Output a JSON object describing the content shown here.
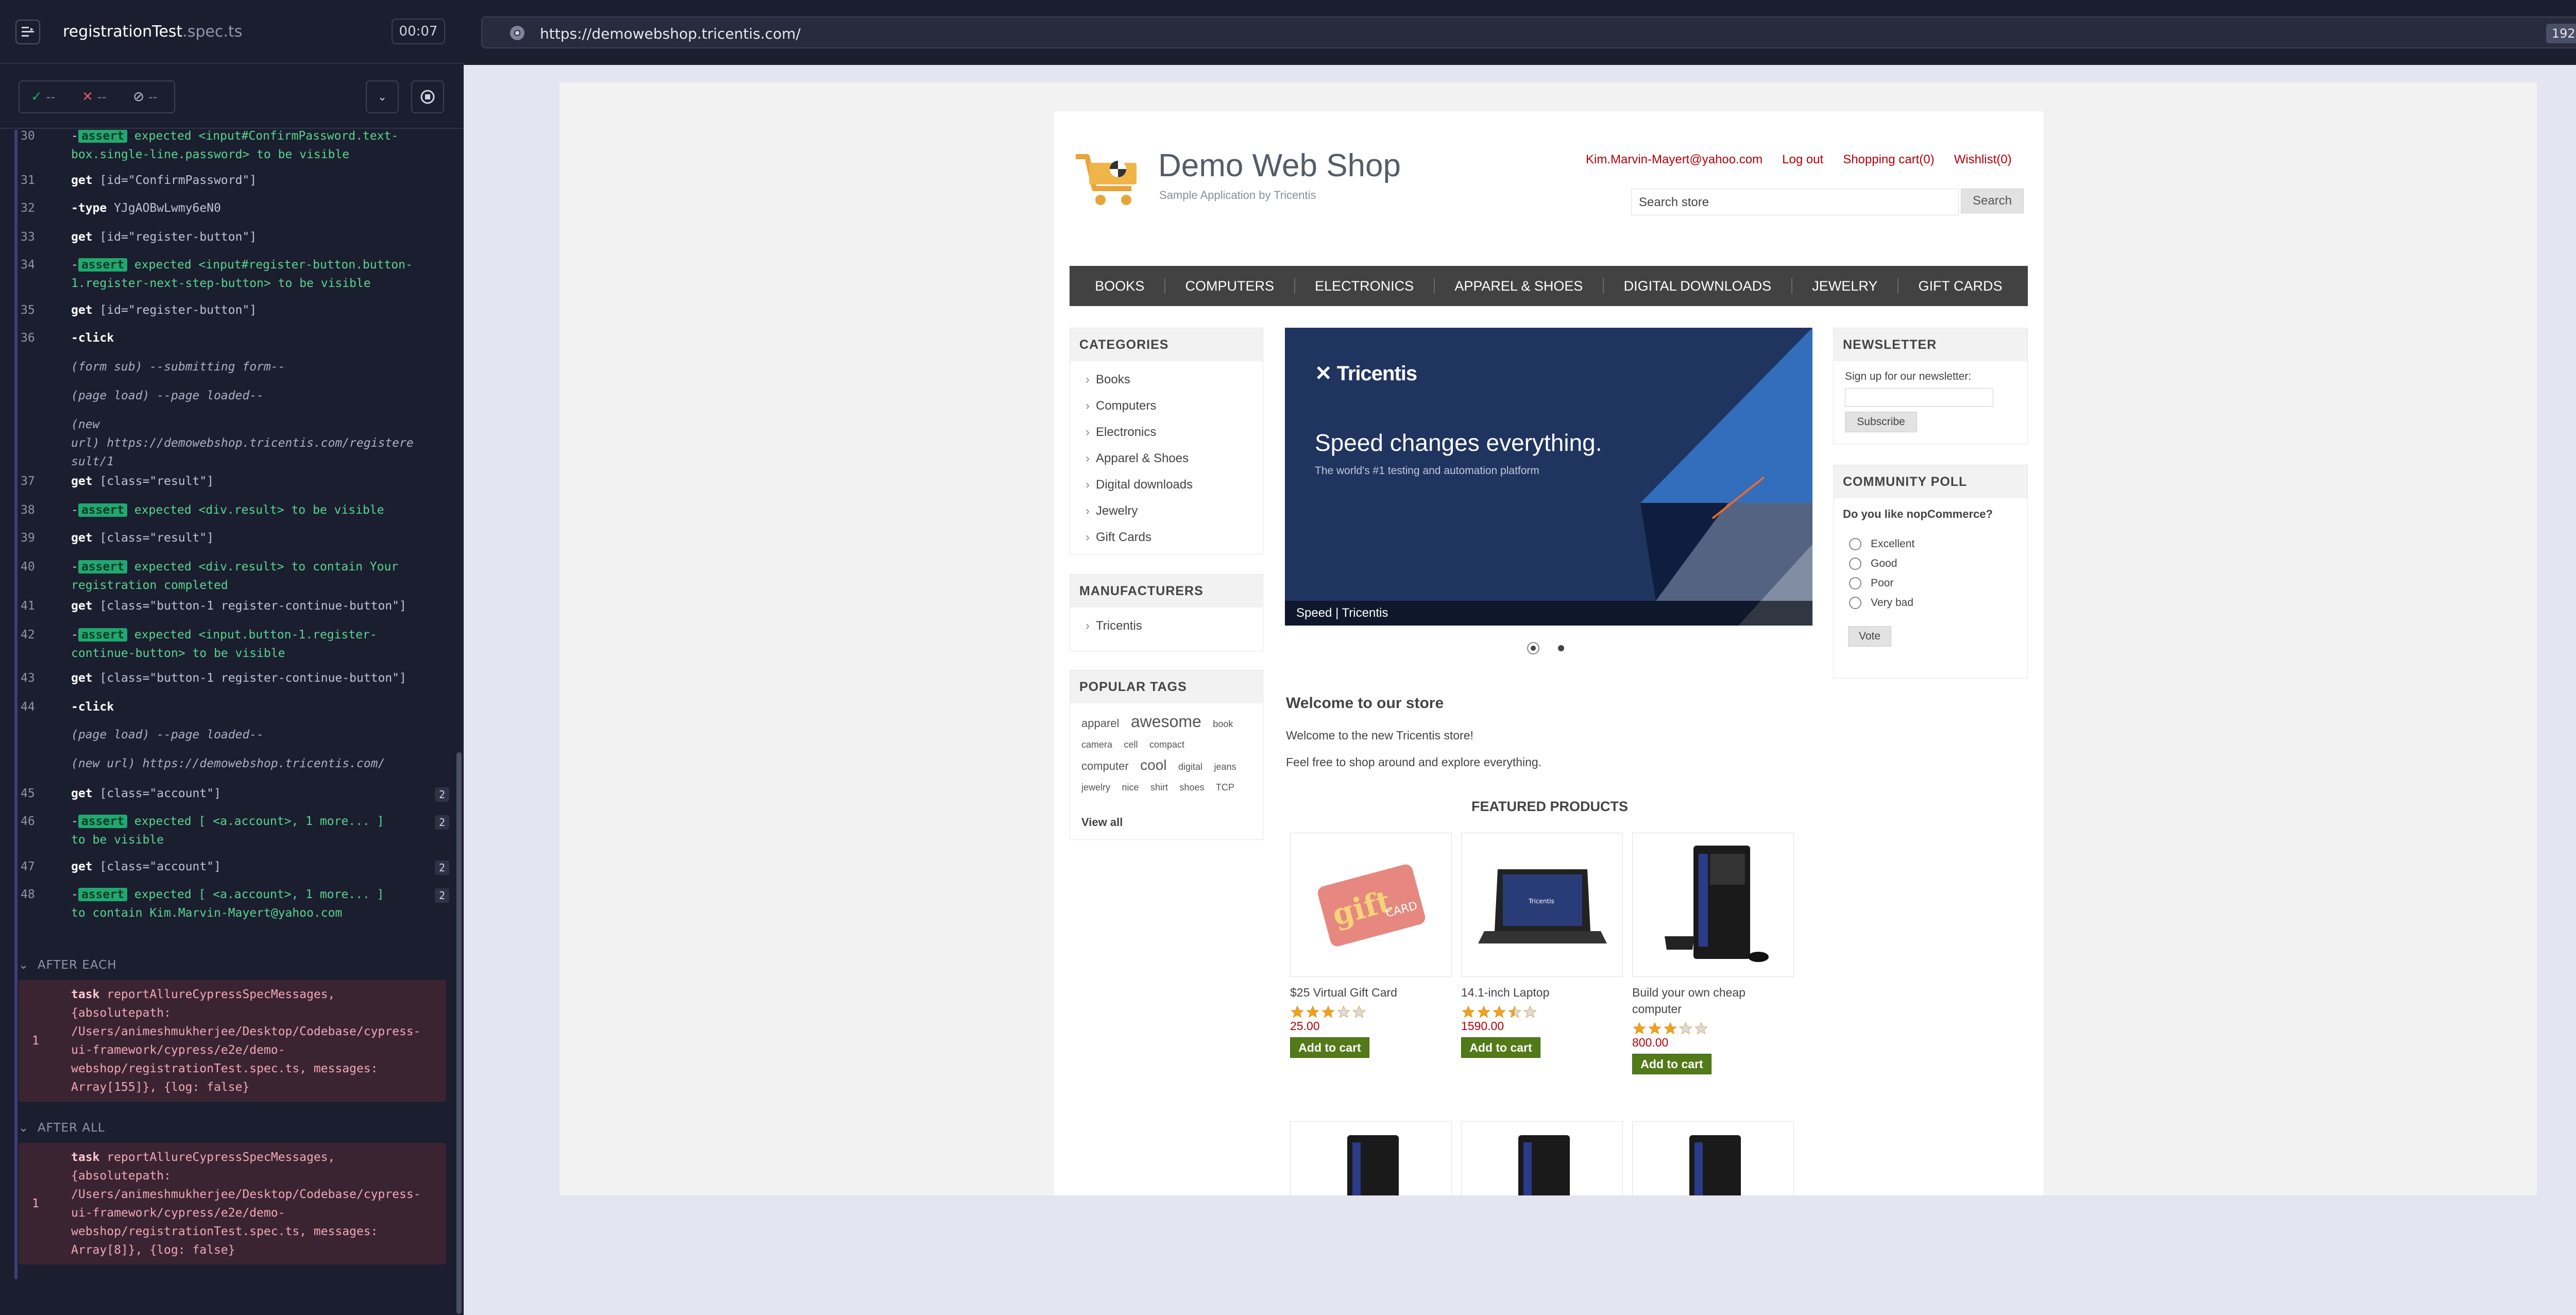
{
  "runner": {
    "spec_name": "registrationTest",
    "spec_ext": ".spec.ts",
    "timer": "00:07",
    "stats": {
      "passed": "--",
      "failed": "--",
      "pending": "--"
    }
  },
  "commands": [
    {
      "num": "30",
      "line1_pre": "",
      "tag": "assert",
      "line1": " expected <input#ConfirmPassword.text-",
      "line2": "box.single-line.password> to be visible"
    },
    {
      "num": "31",
      "kw": "get",
      "text": "[id=\"ConfirmPassword\"]"
    },
    {
      "num": "32",
      "kw": "-type",
      "text": "YJgAOBwLwmy6eN0"
    },
    {
      "num": "33",
      "kw": "get",
      "text": "[id=\"register-button\"]"
    },
    {
      "num": "34",
      "tag": "assert",
      "line1": " expected <input#register-button.button-",
      "line2": "1.register-next-step-button> to be visible"
    },
    {
      "num": "35",
      "kw": "get",
      "text": "[id=\"register-button\"]"
    },
    {
      "num": "36",
      "kw": "-click",
      "text": ""
    },
    {
      "num": "",
      "it1": "(form sub)",
      "text": "--submitting form--"
    },
    {
      "num": "",
      "it1": "(page load)",
      "text": "--page loaded--"
    },
    {
      "num": "",
      "it1": "(new",
      "line1": "",
      "it2": "url)",
      "line2": "https://demowebshop.tricentis.com/registere",
      "line3": "sult/1"
    },
    {
      "num": "37",
      "kw": "get",
      "text": "[class=\"result\"]"
    },
    {
      "num": "38",
      "tag": "assert",
      "line1": " expected <div.result> to be visible"
    },
    {
      "num": "39",
      "kw": "get",
      "text": "[class=\"result\"]"
    },
    {
      "num": "40",
      "tag": "assert",
      "line1": " expected <div.result> to contain Your",
      "line2": "registration completed"
    },
    {
      "num": "41",
      "kw": "get",
      "text": "[class=\"button-1 register-continue-button\"]"
    },
    {
      "num": "42",
      "tag": "assert",
      "line1": " expected <input.button-1.register-",
      "line2": "continue-button> to be visible"
    },
    {
      "num": "43",
      "kw": "get",
      "text": "[class=\"button-1 register-continue-button\"]"
    },
    {
      "num": "44",
      "kw": "-click",
      "text": ""
    },
    {
      "num": "",
      "it1": "(page load)",
      "text": "--page loaded--"
    },
    {
      "num": "",
      "it1": "(new url)",
      "text": "https://demowebshop.tricentis.com/"
    },
    {
      "num": "45",
      "kw": "get",
      "text": "[class=\"account\"]",
      "badge": "2"
    },
    {
      "num": "46",
      "tag": "assert",
      "line1": " expected [ <a.account>, 1 more... ]",
      "line2": "to be visible",
      "badge": "2"
    },
    {
      "num": "47",
      "kw": "get",
      "text": "[class=\"account\"]",
      "badge": "2"
    },
    {
      "num": "48",
      "tag": "assert",
      "line1": " expected [ <a.account>, 1 more... ]",
      "line2": "to contain Kim.Marvin-Mayert@yahoo.com",
      "badge": "2"
    }
  ],
  "hooks": {
    "after_each_label": "AFTER EACH",
    "after_each": {
      "num": "1",
      "kw": "task",
      "lines": [
        "reportAllureCypressSpecMessages,",
        "{absolutepath:",
        "/Users/animeshmukherjee/Desktop/Codebase/cypress-",
        "ui-framework/cypress/e2e/demo-",
        "webshop/registrationTest.spec.ts, messages:",
        "Array[155]}, {log: false}"
      ]
    },
    "after_all_label": "AFTER ALL",
    "after_all": {
      "num": "1",
      "kw": "task",
      "lines": [
        "reportAllureCypressSpecMessages,",
        "{absolutepath:",
        "/Users/animeshmukherjee/Desktop/Codebase/cypress-",
        "ui-framework/cypress/e2e/demo-",
        "webshop/registrationTest.spec.ts, messages:",
        "Array[8]}, {log: false}"
      ]
    }
  },
  "browser": {
    "url": "https://demowebshop.tricentis.com/",
    "viewport": "1920x1080"
  },
  "shop": {
    "title": "Demo Web Shop",
    "subtitle": "Sample Application by Tricentis",
    "header_links": [
      "Kim.Marvin-Mayert@yahoo.com",
      "Log out",
      "Shopping cart(0)",
      "Wishlist(0)"
    ],
    "search_placeholder": "Search store",
    "search_button": "Search",
    "menu": [
      "BOOKS",
      "COMPUTERS",
      "ELECTRONICS",
      "APPAREL & SHOES",
      "DIGITAL DOWNLOADS",
      "JEWELRY",
      "GIFT CARDS"
    ],
    "categories_title": "CATEGORIES",
    "categories": [
      "Books",
      "Computers",
      "Electronics",
      "Apparel & Shoes",
      "Digital downloads",
      "Jewelry",
      "Gift Cards"
    ],
    "manufacturers_title": "MANUFACTURERS",
    "manufacturers": [
      "Tricentis"
    ],
    "tags_title": "POPULAR TAGS",
    "tags": [
      {
        "t": "apparel",
        "s": "m"
      },
      {
        "t": "awesome",
        "s": "xl"
      },
      {
        "t": "book",
        "s": "s"
      },
      {
        "t": "camera",
        "s": "s"
      },
      {
        "t": "cell",
        "s": "s"
      },
      {
        "t": "compact",
        "s": "s"
      },
      {
        "t": "computer",
        "s": "m"
      },
      {
        "t": "cool",
        "s": "l"
      },
      {
        "t": "digital",
        "s": "s"
      },
      {
        "t": "jeans",
        "s": "s"
      },
      {
        "t": "jewelry",
        "s": "s"
      },
      {
        "t": "nice",
        "s": "s"
      },
      {
        "t": "shirt",
        "s": "s"
      },
      {
        "t": "shoes",
        "s": "s"
      },
      {
        "t": "TCP",
        "s": "s"
      }
    ],
    "tags_view_all": "View all",
    "slider": {
      "logo": "Tricentis",
      "headline": "Speed changes everything.",
      "sub": "The world's #1 testing and automation platform",
      "caption": "Speed | Tricentis"
    },
    "welcome_title": "Welcome to our store",
    "welcome_1": "Welcome to the new Tricentis store!",
    "welcome_2": "Feel free to shop around and explore everything.",
    "featured_title": "FEATURED PRODUCTS",
    "products": [
      {
        "name": "$25 Virtual Gift Card",
        "price": "25.00",
        "rating": 3,
        "button": "Add to cart"
      },
      {
        "name": "14.1-inch Laptop",
        "price": "1590.00",
        "rating": 3.5,
        "button": "Add to cart"
      },
      {
        "name": "Build your own cheap computer",
        "price": "800.00",
        "rating": 3,
        "button": "Add to cart"
      }
    ],
    "newsletter_title": "NEWSLETTER",
    "newsletter_label": "Sign up for our newsletter:",
    "newsletter_button": "Subscribe",
    "poll_title": "COMMUNITY POLL",
    "poll_question": "Do you like nopCommerce?",
    "poll_options": [
      "Excellent",
      "Good",
      "Poor",
      "Very bad"
    ],
    "poll_button": "Vote"
  },
  "colors": {
    "accent_red": "#b4000a",
    "cart_green": "#527a18",
    "pass": "#1fa971",
    "fail": "#e45770"
  }
}
